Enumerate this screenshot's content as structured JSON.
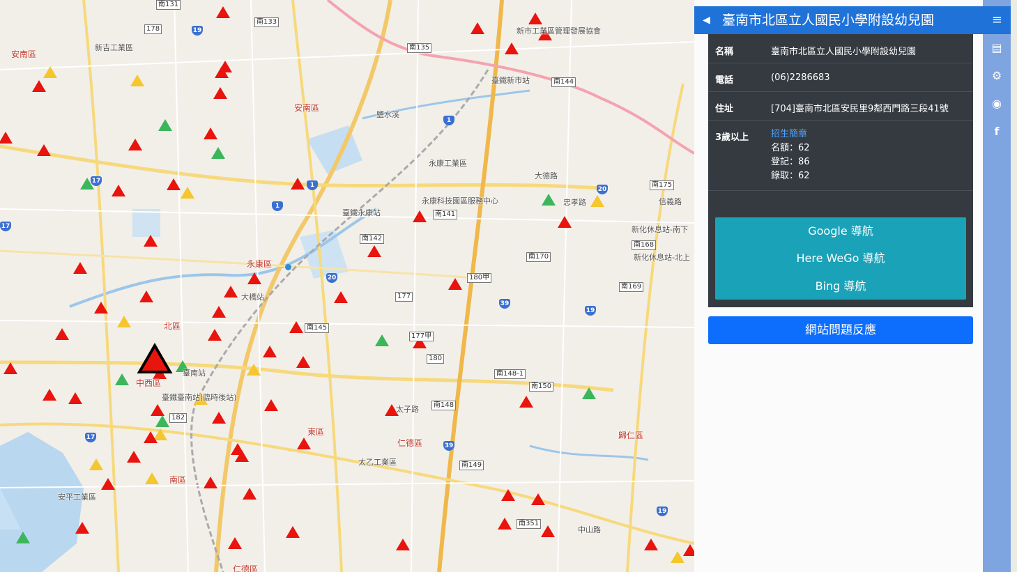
{
  "panel": {
    "back_icon": "◀",
    "title": "臺南市北區立人國民小學附設幼兒園",
    "menu_icon": "≡"
  },
  "info": {
    "name_label": "名稱",
    "name_value": "臺南市北區立人國民小學附設幼兒園",
    "phone_label": "電話",
    "phone_value": "(06)2286683",
    "address_label": "住址",
    "address_value": "[704]臺南市北區安民里9鄰西門路三段41號",
    "age_label": "3歲以上",
    "enroll_link": "招生簡章",
    "quota": "名額：62",
    "registered": "登記：86",
    "admitted": "錄取：62"
  },
  "nav": {
    "google": "Google 導航",
    "here": "Here WeGo 導航",
    "bing": "Bing 導航"
  },
  "report_button": "網站問題反應",
  "sidebar_tabs": [
    "book-icon",
    "gear-icon",
    "github-icon",
    "facebook-icon"
  ],
  "map": {
    "districts": [
      "安南區",
      "安南區",
      "北區",
      "中西區",
      "南區",
      "東區",
      "仁德區",
      "永康區",
      "歸仁區",
      "仁德區"
    ],
    "places": [
      "新吉工業區",
      "臺鐵新市站",
      "新市工業區管理發展協會",
      "永康工業區",
      "永康科技園區服務中心",
      "臺鐵永康站",
      "大橋站",
      "臺南站",
      "臺鐵臺南站(臨時後站)",
      "太乙工業區",
      "太子路",
      "安平工業區",
      "新化休息站-南下",
      "新化休息站-北上",
      "大德路",
      "忠孝路",
      "信義路",
      "中山路",
      "鹽水溪"
    ],
    "road_numbers": [
      "南131",
      "南133",
      "南135",
      "南144",
      "南141",
      "南142",
      "南145",
      "南170",
      "南168",
      "南169",
      "南175",
      "南148",
      "南148-1",
      "南150",
      "南149",
      "南351",
      "177",
      "177甲",
      "180",
      "180甲",
      "182",
      "178"
    ]
  },
  "colors": {
    "header_blue": "#1f72d8",
    "card_dark": "#343a40",
    "nav_teal": "#1aa2b8",
    "report_blue": "#0d6efd",
    "marker_red": "#e8140d",
    "marker_green": "#3cb65a",
    "marker_yellow": "#f5c62e"
  }
}
